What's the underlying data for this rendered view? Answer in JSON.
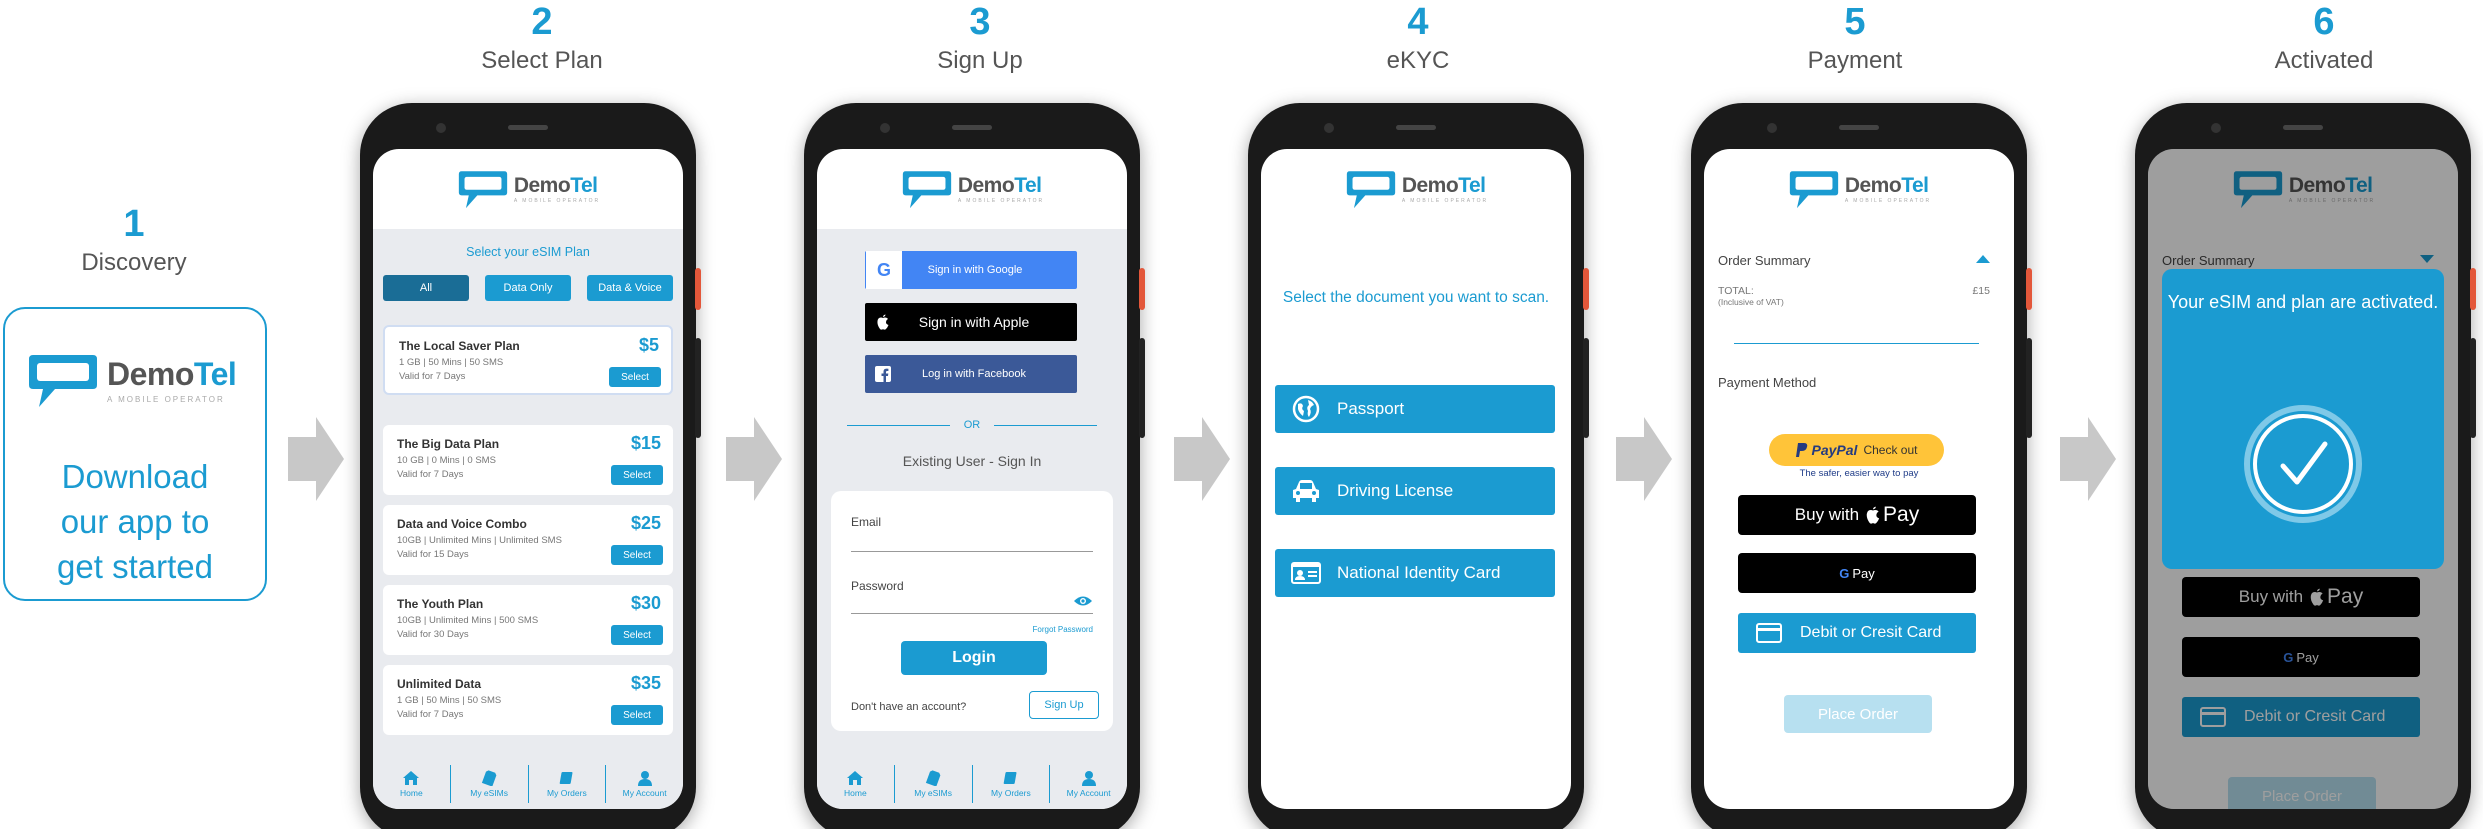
{
  "steps": [
    {
      "num": "1",
      "label": "Discovery"
    },
    {
      "num": "2",
      "label": "Select Plan"
    },
    {
      "num": "3",
      "label": "Sign Up"
    },
    {
      "num": "4",
      "label": "eKYC"
    },
    {
      "num": "5",
      "label": "Payment"
    },
    {
      "num": "6",
      "label": "Activated"
    }
  ],
  "brand": {
    "name_a": "Demo",
    "name_b": "Tel",
    "tagline": "A MOBILE OPERATOR",
    "accent": "#1b9bd1"
  },
  "discovery": {
    "line1": "Download",
    "line2": "our app to",
    "line3": "get started"
  },
  "plans_screen": {
    "title": "Select your eSIM Plan",
    "filters": [
      "All",
      "Data Only",
      "Data & Voice"
    ],
    "plans": [
      {
        "name": "The Local Saver Plan",
        "detail": "1 GB | 50 Mins | 50 SMS",
        "validity": "Valid for 7 Days",
        "price": "$5",
        "action": "Select"
      },
      {
        "name": "The Big Data Plan",
        "detail": "10 GB | 0 Mins | 0 SMS",
        "validity": "Valid for 7 Days",
        "price": "$15",
        "action": "Select"
      },
      {
        "name": "Data and Voice Combo",
        "detail": "10GB | Unlimited Mins | Unlimited SMS",
        "validity": "Valid for 15 Days",
        "price": "$25",
        "action": "Select"
      },
      {
        "name": "The Youth Plan",
        "detail": "10GB | Unlimited Mins | 500 SMS",
        "validity": "Valid for 30 Days",
        "price": "$30",
        "action": "Select"
      },
      {
        "name": "Unlimited Data",
        "detail": "1 GB | 50 Mins | 50 SMS",
        "validity": "Valid for 7 Days",
        "price": "$35",
        "action": "Select"
      }
    ]
  },
  "tabs": [
    "Home",
    "My eSIMs",
    "My Orders",
    "My Account"
  ],
  "signup_screen": {
    "google": "Sign in with Google",
    "apple": "Sign in with Apple",
    "facebook": "Log in with Facebook",
    "or": "OR",
    "existing": "Existing User - Sign In",
    "email_label": "Email",
    "password_label": "Password",
    "forgot": "Forgot Password",
    "login": "Login",
    "no_account": "Don't have an account?",
    "signup": "Sign Up"
  },
  "ekyc_screen": {
    "prompt": "Select the document you want to scan.",
    "documents": [
      "Passport",
      "Driving License",
      "National Identity Card"
    ]
  },
  "payment_screen": {
    "order_summary": "Order Summary",
    "total_label": "TOTAL:",
    "total_value": "£15",
    "vat_note": "(Inclusive of VAT)",
    "payment_method": "Payment Method",
    "paypal_brand": "PayPal",
    "paypal_action": "Check out",
    "paypal_sub": "The safer, easier way to pay",
    "apple_pay": "Buy with",
    "apple_pay_brand": "Pay",
    "google_pay": "Pay",
    "card": "Debit or Cresit Card",
    "place_order": "Place Order"
  },
  "activated_screen": {
    "order_summary": "Order Summary",
    "message": "Your eSIM and plan are activated.",
    "apple_pay": "Buy with",
    "apple_pay_brand": "Pay",
    "google_pay": "Pay",
    "card": "Debit or Cresit Card",
    "place_order": "Place Order"
  }
}
